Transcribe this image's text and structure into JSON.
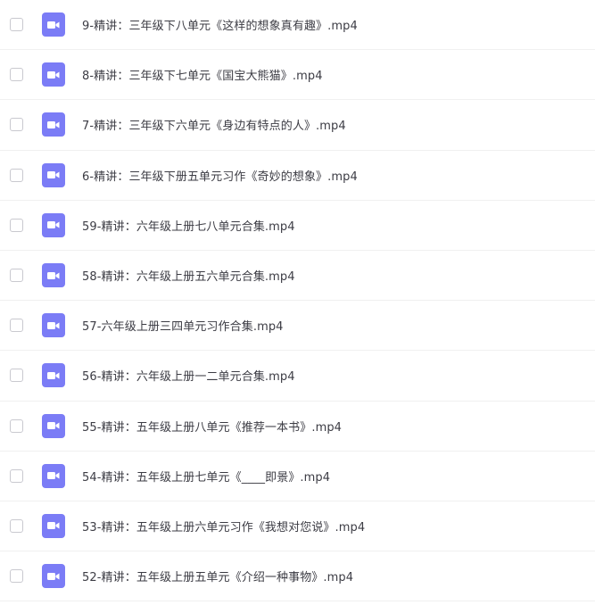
{
  "file_list": {
    "accent_color": "#7b7cf6",
    "file_icon": "video-file-icon",
    "items": [
      {
        "name": "9-精讲：三年级下八单元《这样的想象真有趣》.mp4"
      },
      {
        "name": "8-精讲：三年级下七单元《国宝大熊猫》.mp4"
      },
      {
        "name": "7-精讲：三年级下六单元《身边有特点的人》.mp4"
      },
      {
        "name": "6-精讲：三年级下册五单元习作《奇妙的想象》.mp4"
      },
      {
        "name": "59-精讲：六年级上册七八单元合集.mp4"
      },
      {
        "name": "58-精讲：六年级上册五六单元合集.mp4"
      },
      {
        "name": "57-六年级上册三四单元习作合集.mp4"
      },
      {
        "name": "56-精讲：六年级上册一二单元合集.mp4"
      },
      {
        "name": "55-精讲：五年级上册八单元《推荐一本书》.mp4"
      },
      {
        "name": "54-精讲：五年级上册七单元《____即景》.mp4"
      },
      {
        "name": "53-精讲：五年级上册六单元习作《我想对您说》.mp4"
      },
      {
        "name": "52-精讲：五年级上册五单元《介绍一种事物》.mp4"
      }
    ]
  }
}
